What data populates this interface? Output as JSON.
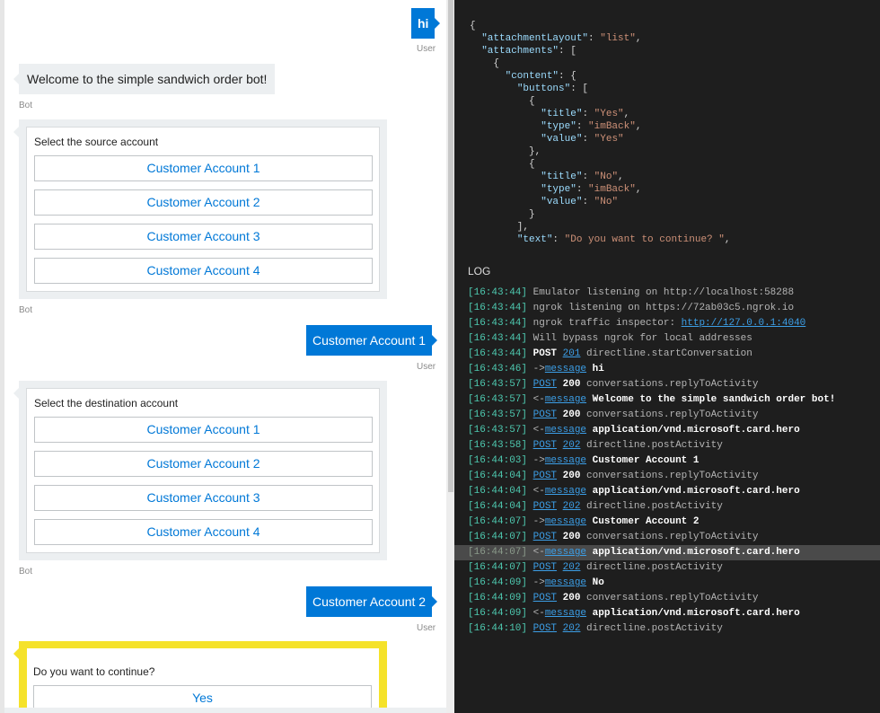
{
  "chat": {
    "messages": [
      {
        "role": "user",
        "text": "hi",
        "sender": "User"
      },
      {
        "role": "bot",
        "text": "Welcome to the simple sandwich order bot!",
        "sender": "Bot"
      },
      {
        "role": "bot-card",
        "text": "Select the source account",
        "buttons": [
          "Customer Account 1",
          "Customer Account 2",
          "Customer Account 3",
          "Customer Account 4"
        ],
        "sender": "Bot"
      },
      {
        "role": "user",
        "text": "Customer Account 1",
        "sender": "User"
      },
      {
        "role": "bot-card",
        "text": "Select the destination account",
        "buttons": [
          "Customer Account 1",
          "Customer Account 2",
          "Customer Account 3",
          "Customer Account 4"
        ],
        "sender": "Bot"
      },
      {
        "role": "user",
        "text": "Customer Account 2",
        "sender": "User"
      },
      {
        "role": "bot-card",
        "text": "Do you want to continue?",
        "buttons": [
          "Yes"
        ],
        "selected": true
      }
    ]
  },
  "inspector": {
    "json_lines": [
      [
        [
          "p",
          "{"
        ]
      ],
      [
        [
          "p",
          "  "
        ],
        [
          "k",
          "\"attachmentLayout\""
        ],
        [
          "p",
          ": "
        ],
        [
          "s",
          "\"list\""
        ],
        [
          "p",
          ","
        ]
      ],
      [
        [
          "p",
          "  "
        ],
        [
          "k",
          "\"attachments\""
        ],
        [
          "p",
          ": ["
        ]
      ],
      [
        [
          "p",
          "    {"
        ]
      ],
      [
        [
          "p",
          "      "
        ],
        [
          "k",
          "\"content\""
        ],
        [
          "p",
          ": {"
        ]
      ],
      [
        [
          "p",
          "        "
        ],
        [
          "k",
          "\"buttons\""
        ],
        [
          "p",
          ": ["
        ]
      ],
      [
        [
          "p",
          "          {"
        ]
      ],
      [
        [
          "p",
          "            "
        ],
        [
          "k",
          "\"title\""
        ],
        [
          "p",
          ": "
        ],
        [
          "s",
          "\"Yes\""
        ],
        [
          "p",
          ","
        ]
      ],
      [
        [
          "p",
          "            "
        ],
        [
          "k",
          "\"type\""
        ],
        [
          "p",
          ": "
        ],
        [
          "s",
          "\"imBack\""
        ],
        [
          "p",
          ","
        ]
      ],
      [
        [
          "p",
          "            "
        ],
        [
          "k",
          "\"value\""
        ],
        [
          "p",
          ": "
        ],
        [
          "s",
          "\"Yes\""
        ]
      ],
      [
        [
          "p",
          "          },"
        ]
      ],
      [
        [
          "p",
          "          {"
        ]
      ],
      [
        [
          "p",
          "            "
        ],
        [
          "k",
          "\"title\""
        ],
        [
          "p",
          ": "
        ],
        [
          "s",
          "\"No\""
        ],
        [
          "p",
          ","
        ]
      ],
      [
        [
          "p",
          "            "
        ],
        [
          "k",
          "\"type\""
        ],
        [
          "p",
          ": "
        ],
        [
          "s",
          "\"imBack\""
        ],
        [
          "p",
          ","
        ]
      ],
      [
        [
          "p",
          "            "
        ],
        [
          "k",
          "\"value\""
        ],
        [
          "p",
          ": "
        ],
        [
          "s",
          "\"No\""
        ]
      ],
      [
        [
          "p",
          "          }"
        ]
      ],
      [
        [
          "p",
          "        ],"
        ]
      ],
      [
        [
          "p",
          "        "
        ],
        [
          "k",
          "\"text\""
        ],
        [
          "p",
          ": "
        ],
        [
          "s",
          "\"Do you want to continue? \""
        ],
        [
          "p",
          ","
        ]
      ]
    ],
    "log_label": "LOG",
    "log": [
      {
        "ts": "[16:43:44]",
        "parts": [
          [
            "plain",
            "Emulator listening on http://localhost:58288"
          ]
        ]
      },
      {
        "ts": "[16:43:44]",
        "parts": [
          [
            "plain",
            "ngrok listening on https://72ab03c5.ngrok.io"
          ]
        ]
      },
      {
        "ts": "[16:43:44]",
        "parts": [
          [
            "plain",
            "ngrok traffic inspector: "
          ],
          [
            "lnk2",
            "http://127.0.0.1:4040"
          ]
        ]
      },
      {
        "ts": "[16:43:44]",
        "parts": [
          [
            "plain",
            "Will bypass ngrok for local addresses"
          ]
        ]
      },
      {
        "ts": "[16:43:44]",
        "parts": [
          [
            "b",
            "POST "
          ],
          [
            "lnk",
            "201"
          ],
          [
            "plain",
            " directline.startConversation"
          ]
        ]
      },
      {
        "ts": "[16:43:46]",
        "parts": [
          [
            "arrow",
            "->"
          ],
          [
            "lnk",
            "message"
          ],
          [
            "b",
            " hi"
          ]
        ]
      },
      {
        "ts": "[16:43:57]",
        "parts": [
          [
            "lnk",
            "POST"
          ],
          [
            "b",
            " 200"
          ],
          [
            "plain",
            " conversations.replyToActivity"
          ]
        ]
      },
      {
        "ts": "[16:43:57]",
        "parts": [
          [
            "arrow",
            "<-"
          ],
          [
            "lnk",
            "message"
          ],
          [
            "b",
            " Welcome to the simple sandwich order bot!"
          ]
        ]
      },
      {
        "ts": "[16:43:57]",
        "parts": [
          [
            "lnk",
            "POST"
          ],
          [
            "b",
            " 200"
          ],
          [
            "plain",
            " conversations.replyToActivity"
          ]
        ]
      },
      {
        "ts": "[16:43:57]",
        "parts": [
          [
            "arrow",
            "<-"
          ],
          [
            "lnk",
            "message"
          ],
          [
            "b",
            " application/vnd.microsoft.card.hero"
          ]
        ]
      },
      {
        "ts": "[16:43:58]",
        "parts": [
          [
            "lnk",
            "POST"
          ],
          [
            "plain",
            " "
          ],
          [
            "lnk",
            "202"
          ],
          [
            "plain",
            " directline.postActivity"
          ]
        ]
      },
      {
        "ts": "[16:44:03]",
        "parts": [
          [
            "arrow",
            "->"
          ],
          [
            "lnk",
            "message"
          ],
          [
            "b",
            " Customer Account 1"
          ]
        ]
      },
      {
        "ts": "[16:44:04]",
        "parts": [
          [
            "lnk",
            "POST"
          ],
          [
            "b",
            " 200"
          ],
          [
            "plain",
            " conversations.replyToActivity"
          ]
        ]
      },
      {
        "ts": "[16:44:04]",
        "parts": [
          [
            "arrow",
            "<-"
          ],
          [
            "lnk",
            "message"
          ],
          [
            "b",
            " application/vnd.microsoft.card.hero"
          ]
        ]
      },
      {
        "ts": "[16:44:04]",
        "parts": [
          [
            "lnk",
            "POST"
          ],
          [
            "plain",
            " "
          ],
          [
            "lnk",
            "202"
          ],
          [
            "plain",
            " directline.postActivity"
          ]
        ]
      },
      {
        "ts": "[16:44:07]",
        "parts": [
          [
            "arrow",
            "->"
          ],
          [
            "lnk",
            "message"
          ],
          [
            "b",
            " Customer Account 2"
          ]
        ]
      },
      {
        "ts": "[16:44:07]",
        "parts": [
          [
            "lnk",
            "POST"
          ],
          [
            "b",
            " 200"
          ],
          [
            "plain",
            " conversations.replyToActivity"
          ]
        ]
      },
      {
        "ts": "[16:44:07]",
        "sel": true,
        "parts": [
          [
            "arrow",
            "<-"
          ],
          [
            "lnk",
            "message"
          ],
          [
            "b",
            " application/vnd.microsoft.card.hero"
          ]
        ]
      },
      {
        "ts": "[16:44:07]",
        "parts": [
          [
            "lnk",
            "POST"
          ],
          [
            "plain",
            " "
          ],
          [
            "lnk",
            "202"
          ],
          [
            "plain",
            " directline.postActivity"
          ]
        ]
      },
      {
        "ts": "[16:44:09]",
        "parts": [
          [
            "arrow",
            "->"
          ],
          [
            "lnk",
            "message"
          ],
          [
            "b",
            " No"
          ]
        ]
      },
      {
        "ts": "[16:44:09]",
        "parts": [
          [
            "lnk",
            "POST"
          ],
          [
            "b",
            " 200"
          ],
          [
            "plain",
            " conversations.replyToActivity"
          ]
        ]
      },
      {
        "ts": "[16:44:09]",
        "parts": [
          [
            "arrow",
            "<-"
          ],
          [
            "lnk",
            "message"
          ],
          [
            "b",
            " application/vnd.microsoft.card.hero"
          ]
        ]
      },
      {
        "ts": "[16:44:10]",
        "parts": [
          [
            "lnk",
            "POST"
          ],
          [
            "plain",
            " "
          ],
          [
            "lnk",
            "202"
          ],
          [
            "plain",
            " directline.postActivity"
          ]
        ]
      }
    ]
  },
  "colors": {
    "accent": "#0078d7",
    "highlight": "#f5e22a",
    "timestamp": "#4ec9b0",
    "json_key": "#9cdcfe",
    "json_string": "#ce9178"
  }
}
